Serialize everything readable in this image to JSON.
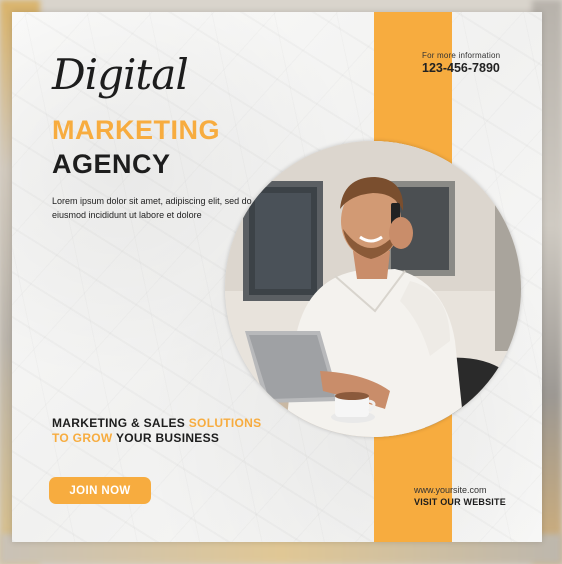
{
  "contact": {
    "label": "For more information",
    "phone": "123-456-7890"
  },
  "title": {
    "line1": "Digital",
    "line2": "MARKETING",
    "line3": "AGENCY"
  },
  "description": "Lorem ipsum dolor sit amet, adipiscing elit, sed do eiusmod incididunt ut labore et dolore",
  "tagline": {
    "part1": "MARKETING & SALES ",
    "part2": "SOLUTIONS",
    "part3": "TO GROW",
    "part4": " YOUR BUSINESS"
  },
  "cta_button": "JOIN NOW",
  "website": {
    "url": "www.yoursite.com",
    "cta": "VISIT OUR WEBSITE"
  },
  "colors": {
    "accent": "#f7ac3f",
    "text": "#1d1d1d",
    "background": "#f5f5f4"
  },
  "photo_subject": "man-on-phone-with-laptop-photo"
}
